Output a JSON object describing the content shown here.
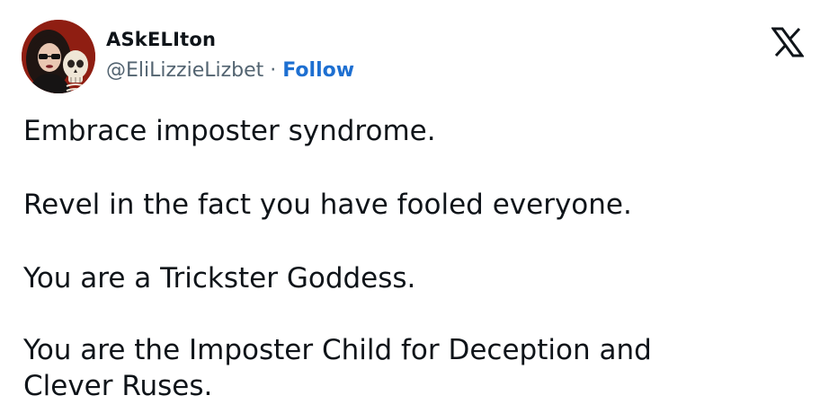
{
  "author": {
    "display_name": "ASkELIton",
    "handle": "@EliLizzieLizbet",
    "separator": "·",
    "follow_label": "Follow"
  },
  "tweet": {
    "lines": [
      "Embrace imposter syndrome.",
      "Revel in the fact you have fooled everyone.",
      "You are a Trickster Goddess.",
      "You are the Imposter Child for Deception and",
      "Clever Ruses."
    ]
  },
  "icons": {
    "logo": "x-logo-icon",
    "avatar": "avatar-image"
  },
  "colors": {
    "text": "#0f1419",
    "secondary_text": "#536471",
    "follow_link": "#1d6fd1",
    "background": "#ffffff"
  }
}
